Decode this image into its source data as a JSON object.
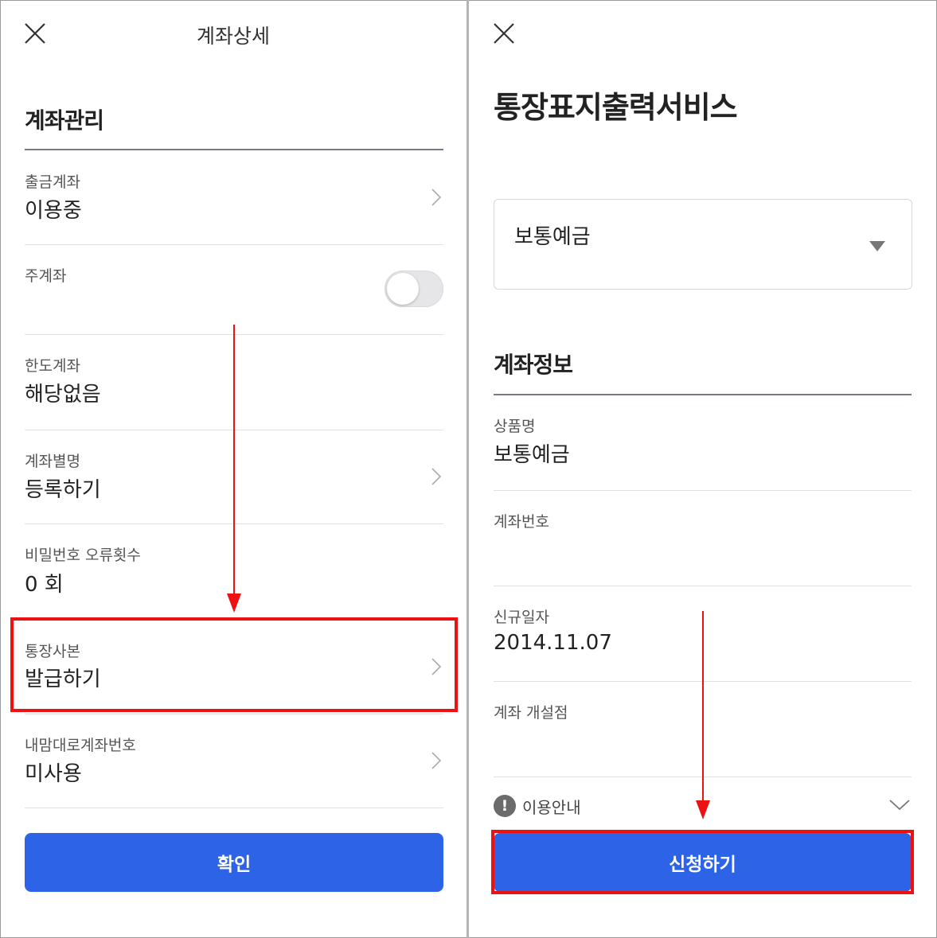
{
  "left": {
    "header_title": "계좌상세",
    "section_title": "계좌관리",
    "rows": [
      {
        "label": "출금계좌",
        "value": "이용중"
      },
      {
        "label": "주계좌",
        "toggle_on": false
      },
      {
        "label": "한도계좌",
        "value": "해당없음"
      },
      {
        "label": "계좌별명",
        "value": "등록하기"
      },
      {
        "label": "비밀번호 오류횟수",
        "value": "0 회"
      },
      {
        "label": "통장사본",
        "value": "발급하기"
      },
      {
        "label": "내맘대로계좌번호",
        "value": "미사용"
      }
    ],
    "confirm_label": "확인"
  },
  "right": {
    "title": "통장표지출력서비스",
    "select_value": "보통예금",
    "section_title": "계좌정보",
    "rows": [
      {
        "label": "상품명",
        "value": "보통예금"
      },
      {
        "label": "계좌번호",
        "value": ""
      },
      {
        "label": "신규일자",
        "value": "2014.11.07"
      },
      {
        "label": "계좌 개설점",
        "value": ""
      }
    ],
    "notice_label": "이용안내",
    "info_symbol": "!",
    "apply_label": "신청하기"
  },
  "colors": {
    "primary": "#2d63e6",
    "highlight": "#ee1111",
    "toggle_off": "#e6e6e9"
  },
  "icons": [
    "close-icon",
    "chevron-right-icon",
    "chevron-down-icon",
    "caret-down-icon",
    "info-icon",
    "arrow-down-icon"
  ]
}
